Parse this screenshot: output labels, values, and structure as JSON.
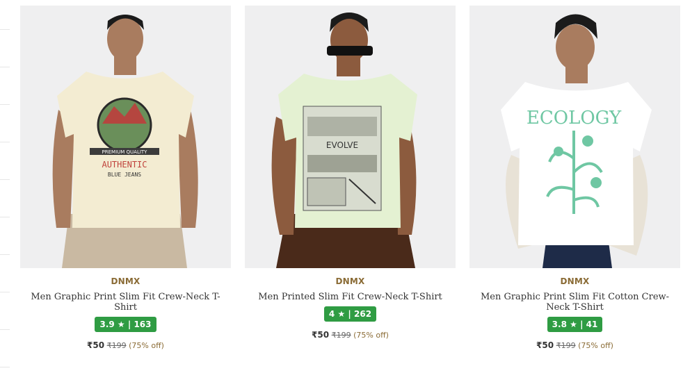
{
  "products": [
    {
      "brand": "DNMX",
      "name": "Men Graphic Print Slim Fit Crew-Neck T-Shirt",
      "rating": "3.9",
      "rating_count": "163",
      "price": "₹50",
      "mrp": "₹199",
      "discount": "(75% off)",
      "tee_color": "#f3ecd2",
      "print_text": [
        "PREMIUM QUALITY",
        "AUTHENTIC",
        "BLUE JEANS"
      ]
    },
    {
      "brand": "DNMX",
      "name": "Men Printed Slim Fit Crew-Neck T-Shirt",
      "rating": "4",
      "rating_count": "262",
      "price": "₹50",
      "mrp": "₹199",
      "discount": "(75% off)",
      "tee_color": "#e4f1d2",
      "print_text": [
        "EVOLVE"
      ]
    },
    {
      "brand": "DNMX",
      "name": "Men Graphic Print Slim Fit Cotton Crew-Neck T-Shirt",
      "rating": "3.8",
      "rating_count": "41",
      "price": "₹50",
      "mrp": "₹199",
      "discount": "(75% off)",
      "tee_color": "#ffffff",
      "print_text": [
        "ECOLOGY"
      ]
    }
  ],
  "icons": {
    "rating_star": "star-icon"
  },
  "colors": {
    "rating_badge": "#2f9c43",
    "brand": "#8a6b35"
  }
}
